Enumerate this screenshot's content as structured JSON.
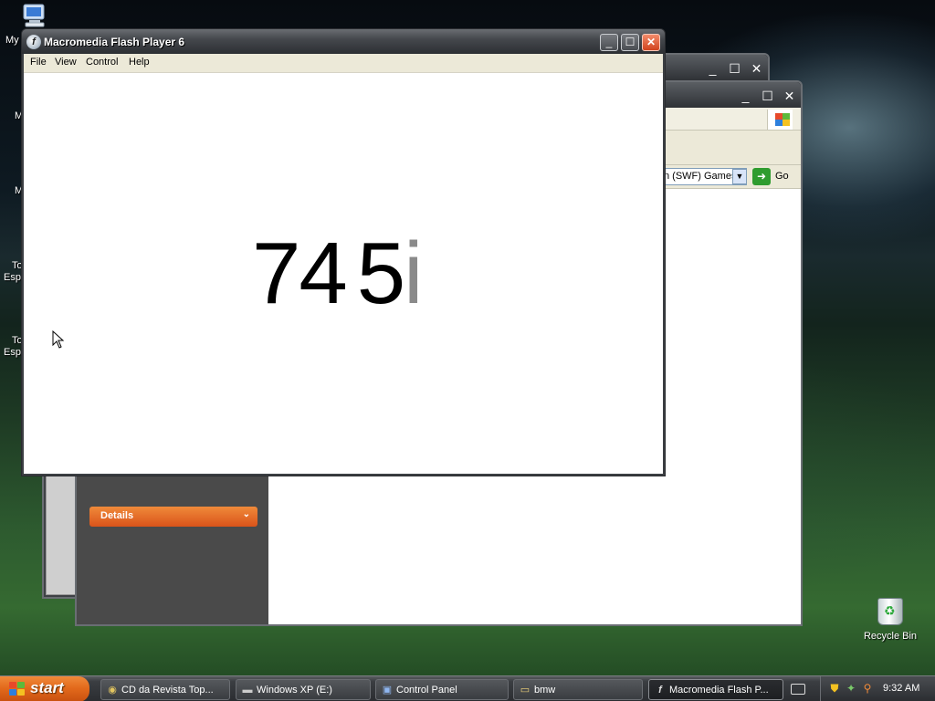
{
  "desktop": {
    "icons": [
      {
        "label_fragment": "My"
      },
      {
        "label_fragment": "M"
      },
      {
        "label_fragment": "M"
      },
      {
        "label_fragment": "To"
      },
      {
        "label_fragment": "Esp"
      },
      {
        "label_fragment": "To"
      },
      {
        "label_fragment": "Esp"
      }
    ],
    "recycle_bin": {
      "label": "Recycle Bin"
    }
  },
  "background_window": {
    "address_value": "n (SWF) Games",
    "go_label": "Go",
    "task_pane": {
      "details_label": "Details"
    }
  },
  "flash_window": {
    "title": "Macromedia Flash Player 6",
    "menu": [
      "File",
      "View",
      "Control",
      "Help"
    ],
    "content": {
      "part1": "74",
      "part2": "5",
      "part3": "i"
    }
  },
  "taskbar": {
    "start_label": "start",
    "items": [
      {
        "label": "CD da Revista Top..."
      },
      {
        "label": "Windows XP (E:)"
      },
      {
        "label": "Control Panel"
      },
      {
        "label": "bmw"
      },
      {
        "label": "Macromedia Flash P..."
      }
    ],
    "clock": "9:32 AM"
  },
  "colors": {
    "start_orange": "#e36a1c",
    "close_red": "#d1441e",
    "details_orange": "#e2661f",
    "go_green": "#2f9c2f"
  }
}
